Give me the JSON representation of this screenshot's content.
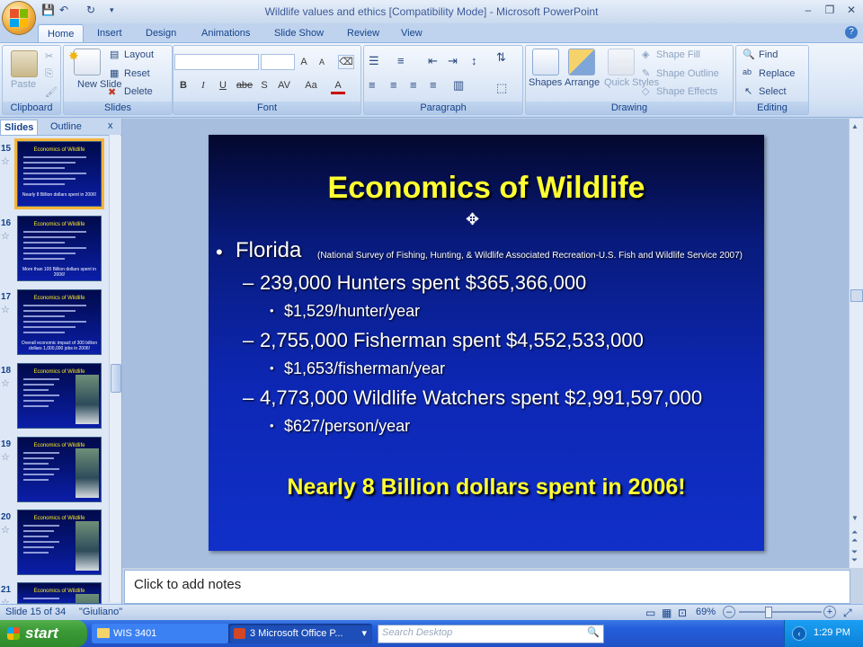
{
  "window": {
    "title": "Wildlife values and ethics [Compatibility Mode] - Microsoft PowerPoint",
    "minimize": "–",
    "restore": "❐",
    "close": "✕"
  },
  "tabs": [
    "Home",
    "Insert",
    "Design",
    "Animations",
    "Slide Show",
    "Review",
    "View"
  ],
  "ribbon": {
    "clipboard": {
      "label": "Clipboard",
      "paste": "Paste"
    },
    "slides": {
      "label": "Slides",
      "new_slide": "New Slide",
      "layout": "Layout",
      "reset": "Reset",
      "delete": "Delete"
    },
    "font": {
      "label": "Font",
      "bold": "B",
      "italic": "I",
      "underline": "U",
      "strike": "abe",
      "shadow": "S",
      "spacing": "AV",
      "case": "Aa",
      "color": "A",
      "grow": "A",
      "shrink": "A"
    },
    "paragraph": {
      "label": "Paragraph"
    },
    "drawing": {
      "label": "Drawing",
      "shapes": "Shapes",
      "arrange": "Arrange",
      "quick_styles": "Quick Styles",
      "shape_fill": "Shape Fill",
      "shape_outline": "Shape Outline",
      "shape_effects": "Shape Effects"
    },
    "editing": {
      "label": "Editing",
      "find": "Find",
      "replace": "Replace",
      "select": "Select"
    }
  },
  "left_pane": {
    "tabs": [
      "Slides",
      "Outline"
    ],
    "close": "x",
    "thumbnails": [
      {
        "num": "15",
        "title": "Economics of Wildlife",
        "footer": "Nearly 8 Billion dollars spent in 2006!",
        "selected": true
      },
      {
        "num": "16",
        "title": "Economics of Wildlife",
        "footer": "More than 100 Billion dollars spent in 2006!",
        "selected": false
      },
      {
        "num": "17",
        "title": "Economics of Wildlife",
        "footer": "Overall economic impact of 300 billion dollars 1,000,000 jobs in 2006!",
        "selected": false
      },
      {
        "num": "18",
        "title": "Economics of Wildlife",
        "footer": "",
        "selected": false
      },
      {
        "num": "19",
        "title": "Economics of Wildlife",
        "footer": "",
        "selected": false
      },
      {
        "num": "20",
        "title": "Economics of Wildlife",
        "footer": "",
        "selected": false
      },
      {
        "num": "21",
        "title": "Economics of Wildlife",
        "footer": "",
        "selected": false
      }
    ]
  },
  "slide": {
    "title": "Economics of Wildlife",
    "bullet_main": "Florida",
    "source": "(National Survey of Fishing, Hunting, & Wildlife Associated Recreation-U.S. Fish and Wildlife Service 2007)",
    "items": [
      {
        "line": "239,000 Hunters spent $365,366,000",
        "sub": "$1,529/hunter/year"
      },
      {
        "line": "2,755,000 Fisherman spent $4,552,533,000",
        "sub": "$1,653/fisherman/year"
      },
      {
        "line": "4,773,000 Wildlife Watchers spent $2,991,597,000",
        "sub": "$627/person/year"
      }
    ],
    "conclusion": "Nearly 8 Billion dollars spent in 2006!"
  },
  "notes": {
    "placeholder": "Click to add notes"
  },
  "status": {
    "slide": "Slide 15 of 34",
    "theme": "\"Giuliano\"",
    "zoom": "69%",
    "zoom_level": 0.69
  },
  "taskbar": {
    "start": "start",
    "items": [
      "WIS 3401",
      "3 Microsoft Office P..."
    ],
    "search_placeholder": "Search Desktop",
    "clock": "1:29 PM"
  },
  "colors": {
    "slide_title": "#ffff33",
    "slide_bg": "#0d27b4",
    "ribbon": "#d7e4f5",
    "taskbar": "#245edb"
  }
}
